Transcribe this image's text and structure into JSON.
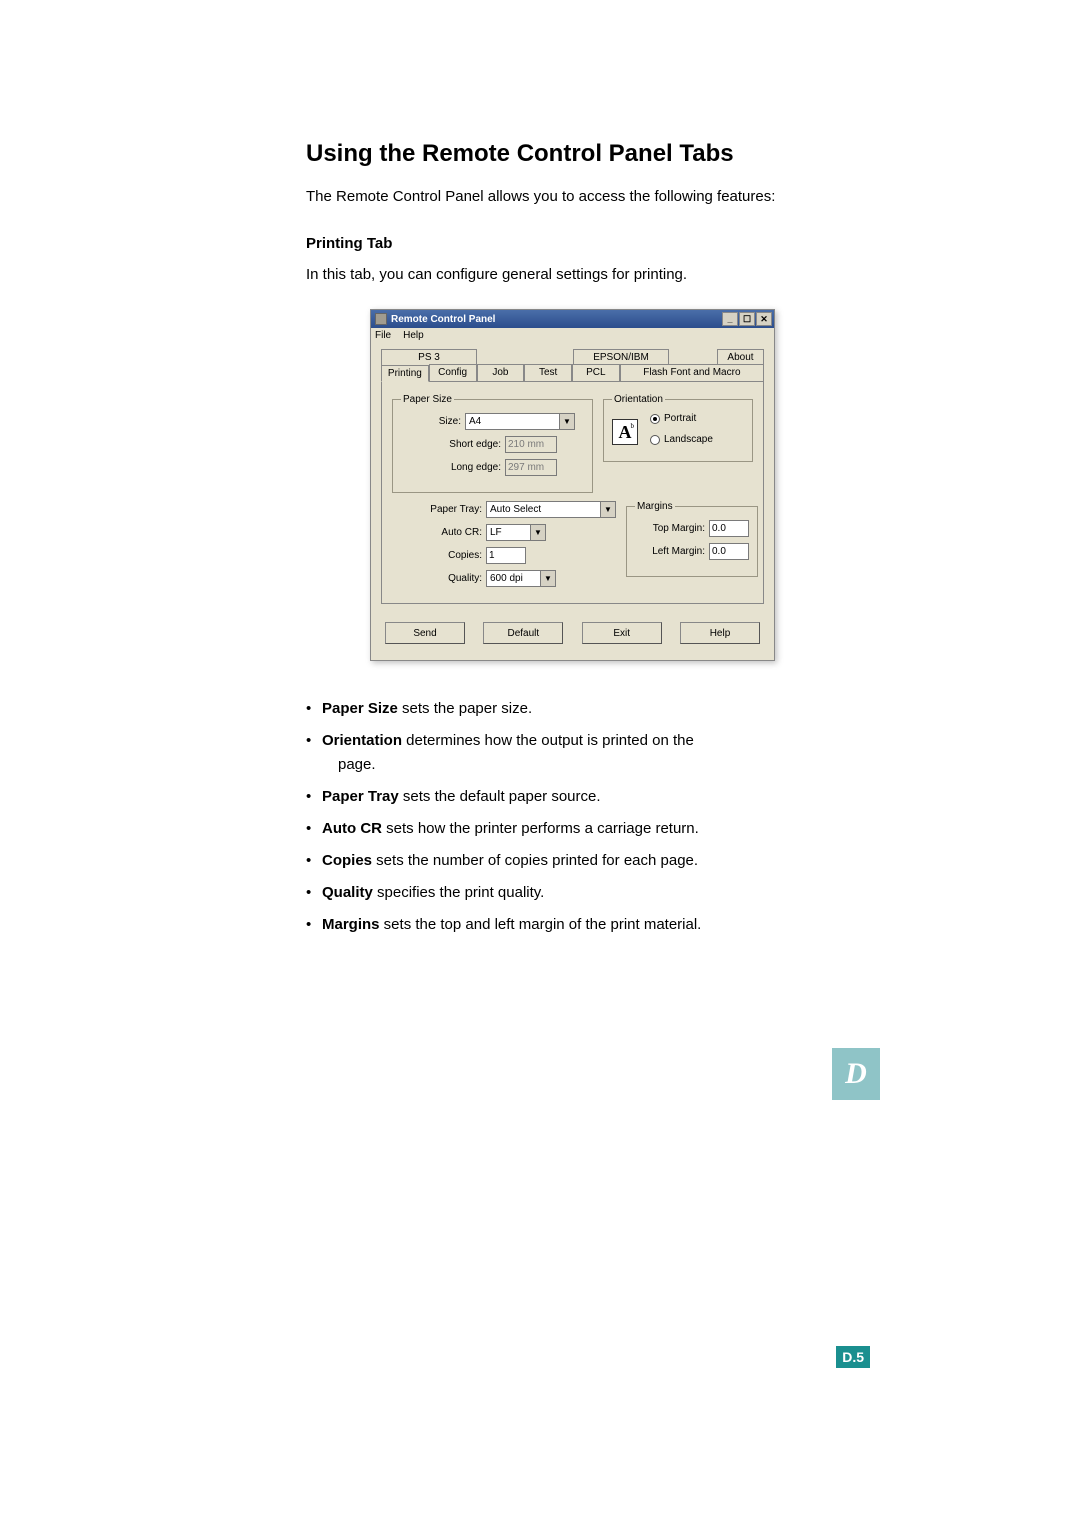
{
  "heading": "Using the Remote Control Panel Tabs",
  "intro": "The Remote Control Panel allows you to access the following features:",
  "printing_tab_title": "Printing Tab",
  "printing_tab_desc": "In this tab, you can configure general settings for printing.",
  "window": {
    "title": "Remote Control Panel",
    "menu": {
      "file": "File",
      "help": "Help"
    },
    "controls": {
      "min": "_",
      "max": "☐",
      "close": "✕"
    },
    "tabs_back": {
      "ps3": "PS 3",
      "epson": "EPSON/IBM",
      "about": "About"
    },
    "tabs_front": {
      "printing": "Printing",
      "config": "Config",
      "job": "Job",
      "test": "Test",
      "pcl": "PCL",
      "flash": "Flash Font and Macro"
    },
    "paper_size": {
      "legend": "Paper Size",
      "size_lbl": "Size:",
      "size_val": "A4",
      "short_lbl": "Short edge:",
      "short_val": "210 mm",
      "long_lbl": "Long edge:",
      "long_val": "297 mm"
    },
    "orientation": {
      "legend": "Orientation",
      "icon_letter": "A",
      "portrait": "Portrait",
      "landscape": "Landscape"
    },
    "paper_tray": {
      "lbl": "Paper Tray:",
      "val": "Auto Select"
    },
    "auto_cr": {
      "lbl": "Auto CR:",
      "val": "LF"
    },
    "copies": {
      "lbl": "Copies:",
      "val": "1"
    },
    "quality": {
      "lbl": "Quality:",
      "val": "600 dpi"
    },
    "margins": {
      "legend": "Margins",
      "top_lbl": "Top Margin:",
      "top_val": "0.0",
      "left_lbl": "Left Margin:",
      "left_val": "0.0"
    },
    "buttons": {
      "send": "Send",
      "default": "Default",
      "exit": "Exit",
      "help": "Help"
    }
  },
  "features": {
    "paper_size": {
      "b": "Paper Size",
      "t": " sets the paper size."
    },
    "orientation": {
      "b": "Orientation",
      "t1": " determines how the output is printed on the",
      "t2": "page."
    },
    "paper_tray": {
      "b": "Paper Tray",
      "t": " sets the default paper source."
    },
    "auto_cr": {
      "b": "Auto CR",
      "t": " sets how the printer performs a carriage return."
    },
    "copies": {
      "b": "Copies",
      "t": " sets the number of copies printed for each page."
    },
    "quality": {
      "b": "Quality",
      "t": " specifies the print quality."
    },
    "margins": {
      "b": "Margins",
      "t": " sets the top and left margin of the print material."
    }
  },
  "side_tab": "D",
  "page_number": {
    "prefix": "D.",
    "num": "5"
  }
}
